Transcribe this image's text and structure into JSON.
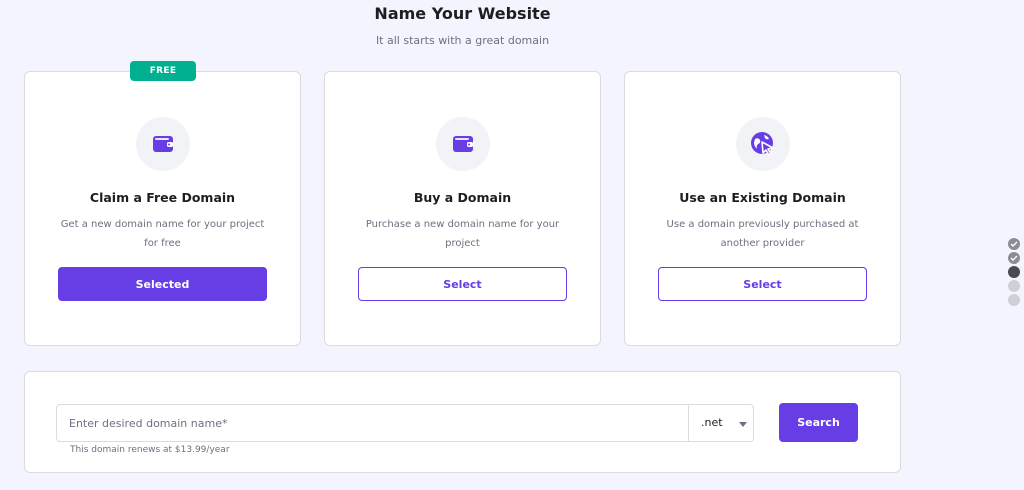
{
  "header": {
    "title": "Name Your Website",
    "subtitle": "It all starts with a great domain"
  },
  "cards": [
    {
      "badge": "FREE",
      "icon": "wallet-icon",
      "title": "Claim a Free Domain",
      "description": "Get a new domain name for your project for free",
      "button": "Selected",
      "selected": true
    },
    {
      "icon": "wallet-icon",
      "title": "Buy a Domain",
      "description": "Purchase a new domain name for your project",
      "button": "Select",
      "selected": false
    },
    {
      "icon": "globe-cursor-icon",
      "title": "Use an Existing Domain",
      "description": "Use a domain previously purchased at another provider",
      "button": "Select",
      "selected": false
    }
  ],
  "search": {
    "placeholder": "Enter desired domain name*",
    "tld": ".net",
    "button": "Search",
    "renewal_note": "This domain renews at $13.99/year"
  },
  "progress_steps": [
    "done",
    "done",
    "current",
    "todo",
    "todo"
  ],
  "colors": {
    "accent": "#673de6",
    "badge": "#00b090",
    "background": "#f4f4fe"
  }
}
